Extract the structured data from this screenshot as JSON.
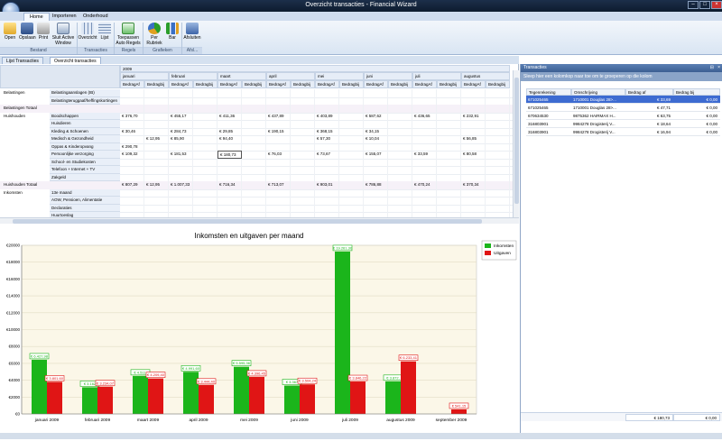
{
  "window": {
    "title": "Overzicht transacties - Financial Wizard"
  },
  "ribbon_tabs": [
    "Home",
    "Importeren",
    "Onderhoud"
  ],
  "ribbon_buttons": {
    "open": "Open",
    "save": "Opslaan",
    "print": "Print",
    "sluit": "Sluit Active Window",
    "overzicht": "Overzicht",
    "lijst": "Lijst",
    "toepassen": "Toepassen Auto Regels",
    "per_rubriek": "Per Rubriek",
    "bar": "Bar",
    "afsluiten": "Afsluiten"
  },
  "ribbon_groups": {
    "bestand": "Bestand",
    "transacties": "Transacties",
    "regels": "Regels",
    "grafieken": "Grafieken",
    "afsl": "Afsl..."
  },
  "doc_tabs": [
    "Lijst Transacties",
    "Overzicht transacties"
  ],
  "grid": {
    "year": "2009",
    "months": [
      "januari",
      "februari",
      "maart",
      "april",
      "mei",
      "juni",
      "juli",
      "augustus"
    ],
    "col_af": "BedragAf",
    "col_bij": "Bedragbij",
    "rows": [
      {
        "cat": "Belastingen",
        "sub": "Belastingaanslagen (IB)",
        "vals": [
          "",
          "",
          "",
          "",
          "",
          "",
          "",
          "",
          "",
          "",
          "",
          "",
          "",
          "",
          "",
          ""
        ]
      },
      {
        "cat": "",
        "sub": "Belastingteruggaaf/heffingskortingen",
        "vals": [
          "",
          "",
          "",
          "",
          "",
          "",
          "",
          "",
          "",
          "",
          "",
          "",
          "",
          "",
          "",
          ""
        ]
      },
      {
        "cat": "Belastingen Totaal",
        "sub": "",
        "vals": [
          "",
          "",
          "",
          "",
          "",
          "",
          "",
          "",
          "",
          "",
          "",
          "",
          "",
          "",
          "",
          ""
        ]
      },
      {
        "cat": "Huishouden",
        "sub": "Boodschappen",
        "vals": [
          "€ 376,70",
          "",
          "€ 455,17",
          "",
          "€ 411,36",
          "",
          "€ 437,89",
          "",
          "€ 403,89",
          "",
          "€ 587,62",
          "",
          "€ 436,65",
          "",
          "€ 232,91",
          ""
        ]
      },
      {
        "cat": "",
        "sub": "Huisdieren",
        "vals": [
          "",
          "",
          "",
          "",
          "",
          "",
          "",
          "",
          "",
          "",
          "",
          "",
          "",
          "",
          "",
          ""
        ]
      },
      {
        "cat": "",
        "sub": "Kleding & Schoenen",
        "vals": [
          "€ 30,46",
          "",
          "€ 284,73",
          "",
          "€ 29,85",
          "",
          "€ 190,15",
          "",
          "€ 368,15",
          "",
          "€ 34,15",
          "",
          "",
          "",
          "",
          ""
        ]
      },
      {
        "cat": "",
        "sub": "Medisch & Gezondheid",
        "vals": [
          "",
          "€ 12,95",
          "€ 85,90",
          "",
          "€ 94,40",
          "",
          "",
          "",
          "€ 57,30",
          "",
          "€ 10,04",
          "",
          "",
          "",
          "€ 56,85",
          ""
        ]
      },
      {
        "cat": "",
        "sub": "Oppas & Kinderopvang",
        "vals": [
          "€ 290,78",
          "",
          "",
          "",
          "",
          "",
          "",
          "",
          "",
          "",
          "",
          "",
          "",
          "",
          "",
          ""
        ]
      },
      {
        "cat": "",
        "sub": "Persoonlijke verzorging",
        "vals": [
          "€ 109,32",
          "",
          "€ 181,53",
          "",
          "€ 180,73",
          "",
          "€ 76,03",
          "",
          "€ 73,67",
          "",
          "€ 155,07",
          "",
          "€ 33,59",
          "",
          "€ 80,58",
          ""
        ]
      },
      {
        "cat": "",
        "sub": "School- en Studiekosten",
        "vals": [
          "",
          "",
          "",
          "",
          "",
          "",
          "",
          "",
          "",
          "",
          "",
          "",
          "",
          "",
          "",
          ""
        ]
      },
      {
        "cat": "",
        "sub": "Telefoon + Internet + TV",
        "vals": [
          "",
          "",
          "",
          "",
          "",
          "",
          "",
          "",
          "",
          "",
          "",
          "",
          "",
          "",
          "",
          ""
        ]
      },
      {
        "cat": "",
        "sub": "Zakgeld",
        "vals": [
          "",
          "",
          "",
          "",
          "",
          "",
          "",
          "",
          "",
          "",
          "",
          "",
          "",
          "",
          "",
          ""
        ]
      },
      {
        "cat": "Huishouden Totaal",
        "sub": "",
        "vals": [
          "€ 807,29",
          "€ 12,95",
          "€ 1.007,33",
          "",
          "€ 716,34",
          "",
          "€ 713,07",
          "",
          "€ 903,01",
          "",
          "€ 786,88",
          "",
          "€ 470,24",
          "",
          "€ 370,34",
          ""
        ]
      },
      {
        "cat": "Inkomsten",
        "sub": "13e maand",
        "vals": [
          "",
          "",
          "",
          "",
          "",
          "",
          "",
          "",
          "",
          "",
          "",
          "",
          "",
          "",
          "",
          ""
        ]
      },
      {
        "cat": "",
        "sub": "AOW, Pensioen, Alimentatie",
        "vals": [
          "",
          "",
          "",
          "",
          "",
          "",
          "",
          "",
          "",
          "",
          "",
          "",
          "",
          "",
          "",
          ""
        ]
      },
      {
        "cat": "",
        "sub": "Declaraties",
        "vals": [
          "",
          "",
          "",
          "",
          "",
          "",
          "",
          "",
          "",
          "",
          "",
          "",
          "",
          "",
          "",
          ""
        ]
      },
      {
        "cat": "",
        "sub": "Huurtoeslag",
        "vals": [
          "",
          "",
          "",
          "",
          "",
          "",
          "",
          "",
          "",
          "",
          "",
          "",
          "",
          "",
          "",
          ""
        ]
      }
    ]
  },
  "transactions_panel": {
    "title": "Transacties",
    "group_hint": "Sleep hier een kolomkop naar toe om te groeperen op die kolom",
    "columns": [
      "Tegenrekening",
      "Omschrijving",
      "Bedrag af",
      "Bedrag bij"
    ],
    "rows": [
      {
        "rek": "671025465",
        "oms": "1710001 Douglas 28>...",
        "af": "€ 33,69",
        "bij": "€ 0,00"
      },
      {
        "rek": "671025465",
        "oms": "1710001 Douglas 28>...",
        "af": "€ 47,71",
        "bij": "€ 0,00"
      },
      {
        "rek": "670634530",
        "oms": "9875362 HAIRMAX H...",
        "af": "€ 63,75",
        "bij": "€ 0,00"
      },
      {
        "rek": "316803901",
        "oms": "9984278 Drogisterij V...",
        "af": "€ 18,64",
        "bij": "€ 0,00"
      },
      {
        "rek": "316803901",
        "oms": "9984278 Drogisterij V...",
        "af": "€ 16,94",
        "bij": "€ 0,00"
      }
    ],
    "total_af": "€ 180,73",
    "total_bij": "€ 0,00"
  },
  "chart_data": {
    "type": "bar",
    "title": "Inkomsten en uitgaven per maand",
    "categories": [
      "januari 2009",
      "februari 2009",
      "maart 2009",
      "april 2009",
      "mei 2009",
      "juni 2009",
      "juli 2009",
      "augustus 2009",
      "september 2009"
    ],
    "series": [
      {
        "name": "Inkomsten",
        "color": "#1bb51b",
        "values": [
          6427.98,
          3162,
          4511,
          4991.6,
          5595.36,
          3367,
          19261.3,
          3872,
          0
        ],
        "labels": [
          "€ 6.427,98",
          "€ 3.162",
          "€ 4.511,",
          "€ 4.991,60",
          "€ 5.595,36",
          "€ 3.367",
          "€ 19.261,30",
          "€ 3.872,",
          ""
        ]
      },
      {
        "name": "Uitgaven",
        "color": "#e01515",
        "values": [
          3801.6,
          3234.07,
          4209.4,
          3444.4,
          4396.45,
          3504.24,
          3846.22,
          6233.41,
          541.15
        ],
        "labels": [
          "€ 3.801,60",
          "€ 3.234,07",
          "€ 4.209,40",
          "€ 3.444,40",
          "€ 4.396,45",
          "€ 3.504,24",
          "€ 3.846,22",
          "€ 6.233,41",
          "€ 541,15"
        ]
      }
    ],
    "ylim": [
      0,
      20000
    ],
    "yticks": [
      "€0",
      "€2000",
      "€4000",
      "€6000",
      "€8000",
      "€10000",
      "€12000",
      "€14000",
      "€16000",
      "€18000",
      "€20000"
    ],
    "legend": "top-right",
    "grid": true
  }
}
